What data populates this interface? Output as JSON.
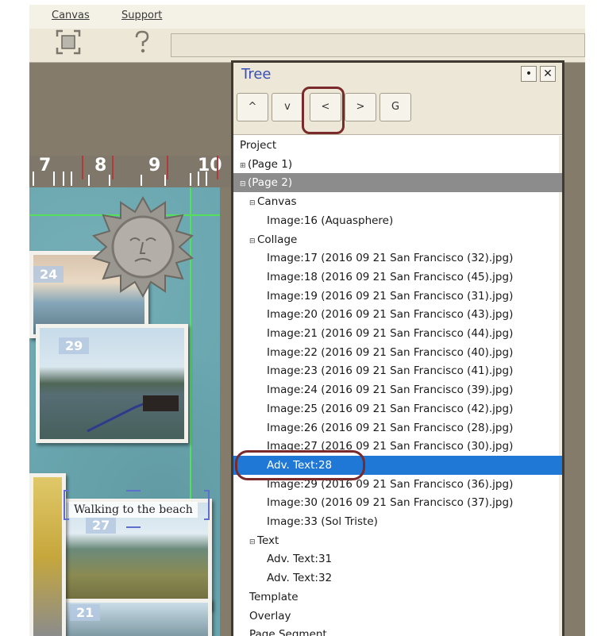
{
  "menu": {
    "canvas": "Canvas",
    "support": "Support"
  },
  "toolbar": {
    "canvas_tool_icon": "fit-canvas-icon",
    "support_tool_icon": "help-icon"
  },
  "ruler": {
    "labels": [
      "7",
      "8",
      "9",
      "10"
    ]
  },
  "canvas": {
    "badges": [
      "24",
      "29",
      "27",
      "21"
    ],
    "caption": "Walking to the beach"
  },
  "tree_panel": {
    "title": "Tree",
    "pin_label": "•",
    "close_label": "✕",
    "nav_buttons": [
      "^",
      "v",
      "<",
      ">",
      "G"
    ],
    "items": [
      {
        "label": "Project",
        "indent": 0,
        "expander": ""
      },
      {
        "label": "(Page 1)",
        "indent": 0,
        "expander": "⊞"
      },
      {
        "label": "(Page 2)",
        "indent": 0,
        "expander": "⊟",
        "state": "selected-gray"
      },
      {
        "label": "Canvas",
        "indent": 1,
        "expander": "⊟"
      },
      {
        "label": "Image:16 (Aquasphere)",
        "indent": 2,
        "expander": ""
      },
      {
        "label": "Collage",
        "indent": 1,
        "expander": "⊟"
      },
      {
        "label": "Image:17 (2016 09 21 San Francisco (32).jpg)",
        "indent": 2,
        "expander": ""
      },
      {
        "label": "Image:18 (2016 09 21 San Francisco (45).jpg)",
        "indent": 2,
        "expander": ""
      },
      {
        "label": "Image:19 (2016 09 21 San Francisco (31).jpg)",
        "indent": 2,
        "expander": ""
      },
      {
        "label": "Image:20 (2016 09 21 San Francisco (43).jpg)",
        "indent": 2,
        "expander": ""
      },
      {
        "label": "Image:21 (2016 09 21 San Francisco (44).jpg)",
        "indent": 2,
        "expander": ""
      },
      {
        "label": "Image:22 (2016 09 21 San Francisco (40).jpg)",
        "indent": 2,
        "expander": ""
      },
      {
        "label": "Image:23 (2016 09 21 San Francisco (41).jpg)",
        "indent": 2,
        "expander": ""
      },
      {
        "label": "Image:24 (2016 09 21 San Francisco (39).jpg)",
        "indent": 2,
        "expander": ""
      },
      {
        "label": "Image:25 (2016 09 21 San Francisco (42).jpg)",
        "indent": 2,
        "expander": ""
      },
      {
        "label": "Image:26 (2016 09 21 San Francisco (28).jpg)",
        "indent": 2,
        "expander": ""
      },
      {
        "label": "Image:27 (2016 09 21 San Francisco (30).jpg)",
        "indent": 2,
        "expander": ""
      },
      {
        "label": "Adv. Text:28",
        "indent": 2,
        "expander": "",
        "state": "selected-blue"
      },
      {
        "label": "Image:29 (2016 09 21 San Francisco (36).jpg)",
        "indent": 2,
        "expander": ""
      },
      {
        "label": "Image:30 (2016 09 21 San Francisco (37).jpg)",
        "indent": 2,
        "expander": ""
      },
      {
        "label": "Image:33 (Sol Triste)",
        "indent": 2,
        "expander": ""
      },
      {
        "label": "Text",
        "indent": 1,
        "expander": "⊟"
      },
      {
        "label": "Adv. Text:31",
        "indent": 2,
        "expander": ""
      },
      {
        "label": "Adv. Text:32",
        "indent": 2,
        "expander": ""
      },
      {
        "label": "Template",
        "indent": 1,
        "expander": ""
      },
      {
        "label": "Overlay",
        "indent": 1,
        "expander": ""
      },
      {
        "label": "Page Segment",
        "indent": 1,
        "expander": ""
      }
    ]
  },
  "colors": {
    "selection_blue": "#1f77d6",
    "selection_gray": "#8c8c8c",
    "title_blue": "#3a4fb5",
    "callout_ring": "#7a2a2a"
  }
}
